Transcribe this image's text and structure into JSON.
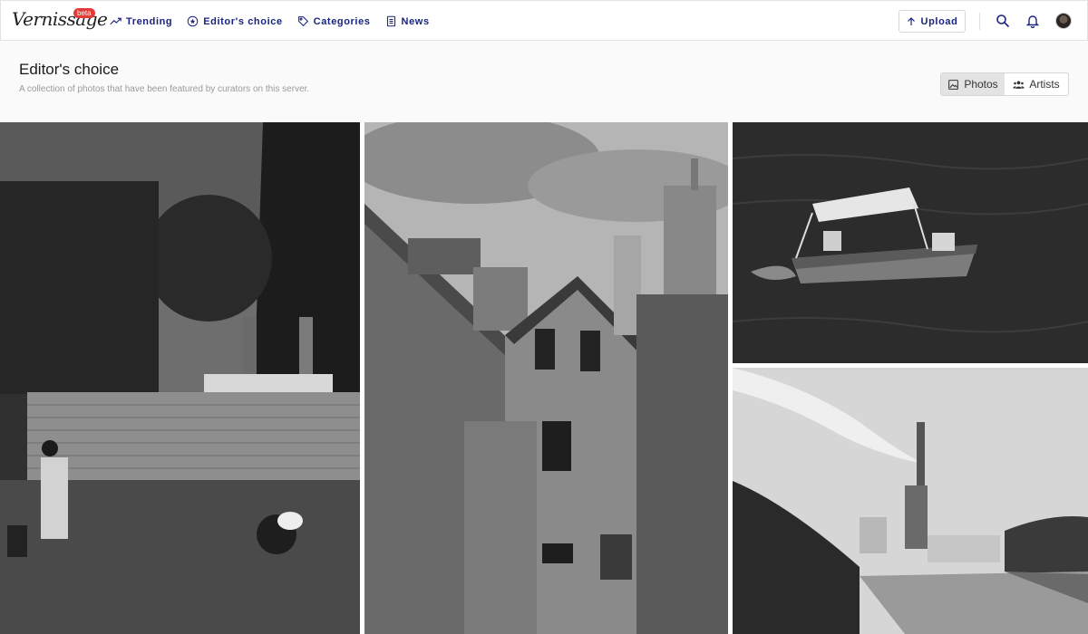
{
  "app": {
    "logo_text": "Vernissage",
    "beta_badge": "beta"
  },
  "nav": {
    "items": [
      {
        "label": "Trending",
        "icon": "trending-icon"
      },
      {
        "label": "Editor's choice",
        "icon": "star-circle-icon"
      },
      {
        "label": "Categories",
        "icon": "tag-icon"
      },
      {
        "label": "News",
        "icon": "document-icon"
      }
    ]
  },
  "toolbar": {
    "upload_label": "Upload",
    "search_icon": "search-icon",
    "notifications_icon": "bell-icon",
    "avatar_icon": "user-avatar"
  },
  "page": {
    "title": "Editor's choice",
    "subtitle": "A collection of photos that have been featured by curators on this server."
  },
  "view_toggle": {
    "photos_label": "Photos",
    "artists_label": "Artists",
    "selected": "Photos"
  },
  "colors": {
    "nav_text": "#1a237e",
    "beta_badge": "#e53935",
    "header_bg": "#fafafa",
    "toggle_active": "#e3e3e3"
  },
  "photos": [
    {
      "subject": "Garden with hedges, statues and people photographing on lawn"
    },
    {
      "subject": "Old weathered house with chimneys"
    },
    {
      "subject": "Small motorboat with canopy on river"
    },
    {
      "subject": "River with industrial chimney smoking in distance"
    }
  ]
}
